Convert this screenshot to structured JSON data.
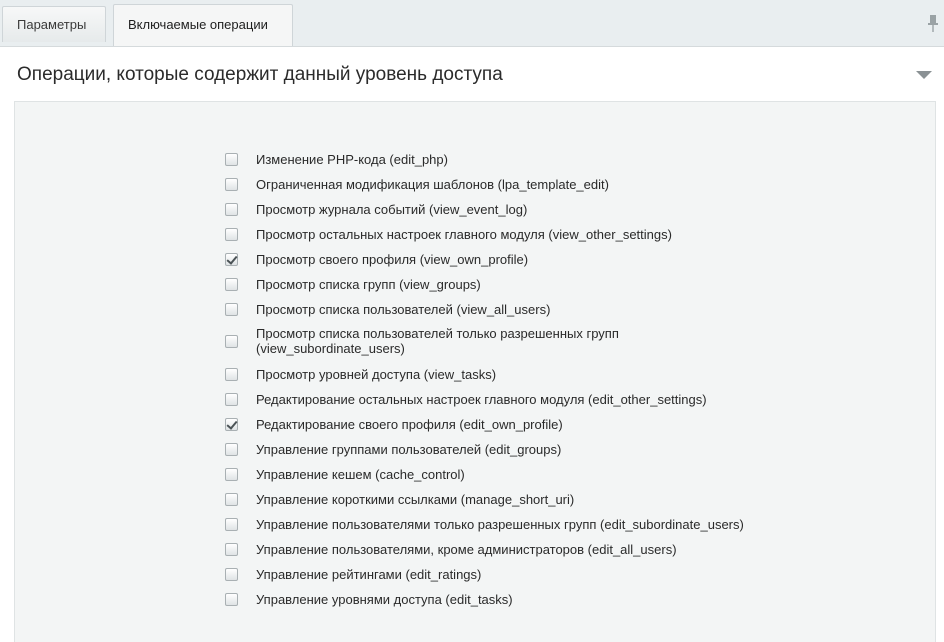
{
  "tabs": [
    {
      "label": "Параметры",
      "active": false
    },
    {
      "label": "Включаемые операции",
      "active": true
    }
  ],
  "section": {
    "title": "Операции, которые содержит данный уровень доступа"
  },
  "operations": [
    {
      "label": "Изменение PHP-кода (edit_php)",
      "checked": false
    },
    {
      "label": "Ограниченная модификация шаблонов (lpa_template_edit)",
      "checked": false
    },
    {
      "label": "Просмотр журнала событий (view_event_log)",
      "checked": false
    },
    {
      "label": "Просмотр остальных настроек главного модуля (view_other_settings)",
      "checked": false
    },
    {
      "label": "Просмотр своего профиля (view_own_profile)",
      "checked": true
    },
    {
      "label": "Просмотр списка групп (view_groups)",
      "checked": false
    },
    {
      "label": "Просмотр списка пользователей (view_all_users)",
      "checked": false
    },
    {
      "label": "Просмотр списка пользователей только разрешенных групп\n(view_subordinate_users)",
      "checked": false
    },
    {
      "label": "Просмотр уровней доступа (view_tasks)",
      "checked": false
    },
    {
      "label": "Редактирование остальных настроек главного модуля (edit_other_settings)",
      "checked": false
    },
    {
      "label": "Редактирование своего профиля (edit_own_profile)",
      "checked": true
    },
    {
      "label": "Управление группами пользователей (edit_groups)",
      "checked": false
    },
    {
      "label": "Управление кешем (cache_control)",
      "checked": false
    },
    {
      "label": "Управление короткими ссылками (manage_short_uri)",
      "checked": false
    },
    {
      "label": "Управление пользователями только разрешенных групп (edit_subordinate_users)",
      "checked": false
    },
    {
      "label": "Управление пользователями, кроме администраторов (edit_all_users)",
      "checked": false
    },
    {
      "label": "Управление рейтингами (edit_ratings)",
      "checked": false
    },
    {
      "label": "Управление уровнями доступа (edit_tasks)",
      "checked": false
    }
  ]
}
